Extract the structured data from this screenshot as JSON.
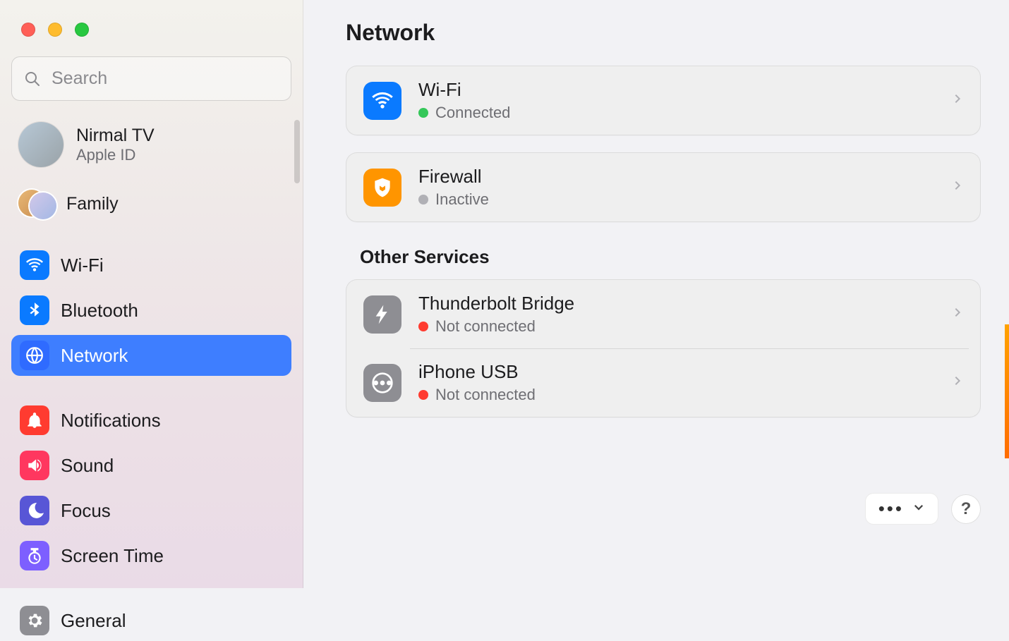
{
  "sidebar": {
    "search_placeholder": "Search",
    "account": {
      "name": "Nirmal TV",
      "sub": "Apple ID"
    },
    "family_label": "Family",
    "items": [
      {
        "id": "wifi",
        "label": "Wi-Fi",
        "color": "bg-blue",
        "selected": false
      },
      {
        "id": "bluetooth",
        "label": "Bluetooth",
        "color": "bg-blue",
        "selected": false
      },
      {
        "id": "network",
        "label": "Network",
        "color": "bg-blue2",
        "selected": true
      },
      {
        "id": "notifications",
        "label": "Notifications",
        "color": "bg-red",
        "selected": false,
        "gap_before": true
      },
      {
        "id": "sound",
        "label": "Sound",
        "color": "bg-pink",
        "selected": false
      },
      {
        "id": "focus",
        "label": "Focus",
        "color": "bg-indigo",
        "selected": false
      },
      {
        "id": "screentime",
        "label": "Screen Time",
        "color": "bg-purple",
        "selected": false
      },
      {
        "id": "general",
        "label": "General",
        "color": "bg-gray",
        "selected": false,
        "gap_before": true
      }
    ]
  },
  "main": {
    "title": "Network",
    "primary": [
      {
        "id": "wifi",
        "title": "Wi-Fi",
        "status": "Connected",
        "dot": "dot-green",
        "icon": "ic-wifi"
      },
      {
        "id": "firewall",
        "title": "Firewall",
        "status": "Inactive",
        "dot": "dot-gray",
        "icon": "ic-firewall"
      }
    ],
    "other_title": "Other Services",
    "other": [
      {
        "id": "thunderbolt",
        "title": "Thunderbolt Bridge",
        "status": "Not connected",
        "dot": "dot-red",
        "icon": "ic-thunder"
      },
      {
        "id": "iphoneusb",
        "title": "iPhone USB",
        "status": "Not connected",
        "dot": "dot-red",
        "icon": "ic-usb"
      }
    ],
    "help_label": "?"
  }
}
